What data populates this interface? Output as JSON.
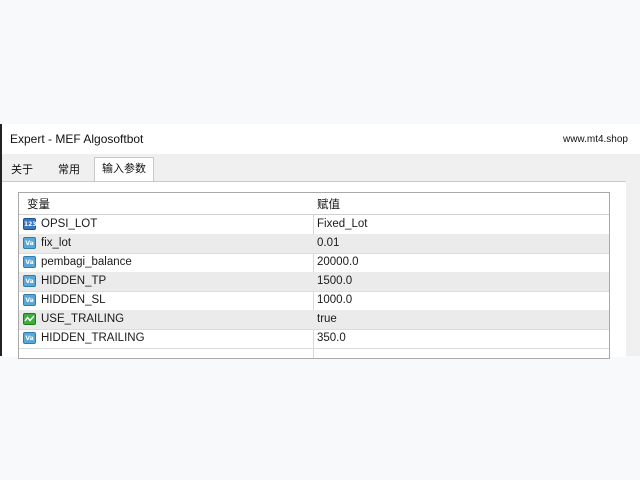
{
  "window": {
    "title": "Expert - MEF Algosoftbot",
    "right_text": "www.mt4.shop"
  },
  "tabs": [
    {
      "label": "关于"
    },
    {
      "label": "常用"
    },
    {
      "label": "输入参数"
    }
  ],
  "table": {
    "headers": {
      "name": "变量",
      "value": "赋值"
    },
    "rows": [
      {
        "icon": "enum-icon",
        "name": "OPSI_LOT",
        "value": "Fixed_Lot"
      },
      {
        "icon": "value-icon",
        "name": "fix_lot",
        "value": "0.01"
      },
      {
        "icon": "value-icon",
        "name": "pembagi_balance",
        "value": "20000.0"
      },
      {
        "icon": "value-icon",
        "name": "HIDDEN_TP",
        "value": "1500.0"
      },
      {
        "icon": "value-icon",
        "name": "HIDDEN_SL",
        "value": "1000.0"
      },
      {
        "icon": "boolean-icon",
        "name": "USE_TRAILING",
        "value": "true"
      },
      {
        "icon": "value-icon",
        "name": "HIDDEN_TRAILING",
        "value": "350.0"
      }
    ]
  },
  "icon_glyphs": {
    "enum": "123",
    "value": "Va"
  }
}
